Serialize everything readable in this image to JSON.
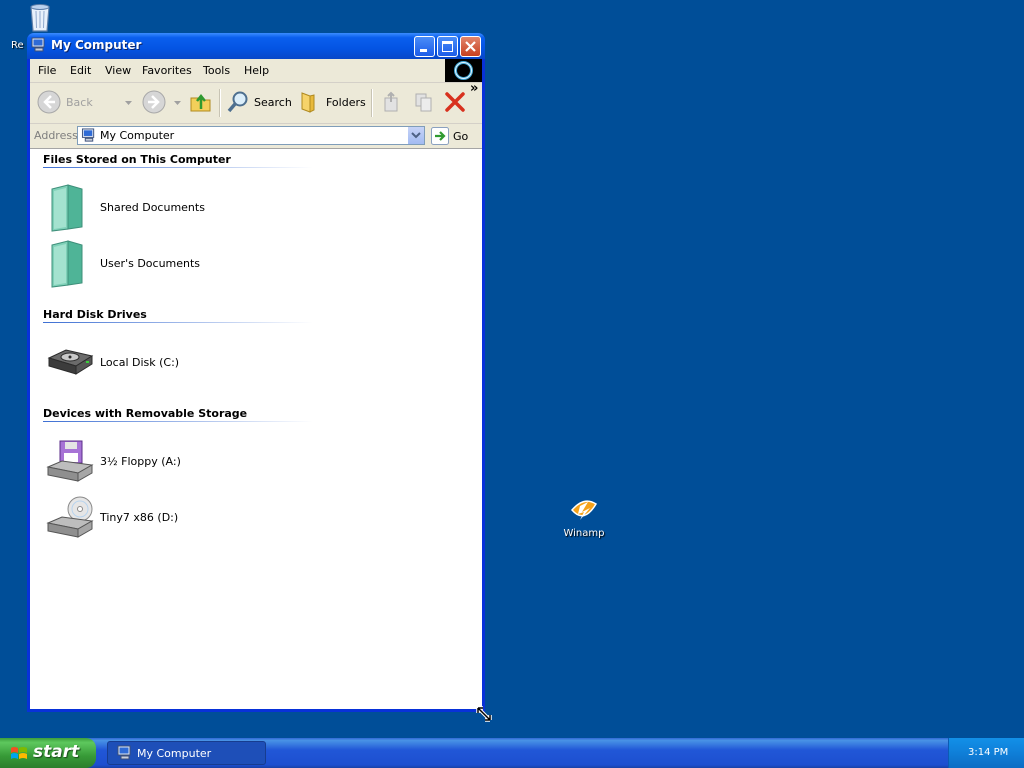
{
  "desktop": {
    "icons": [
      {
        "label": "Re"
      },
      {
        "label": "Winamp"
      }
    ]
  },
  "window": {
    "title": "My Computer",
    "menu": [
      "File",
      "Edit",
      "View",
      "Favorites",
      "Tools",
      "Help"
    ],
    "toolbar": {
      "back": "Back",
      "search": "Search",
      "folders": "Folders",
      "more": "»"
    },
    "address": {
      "label": "Address",
      "value": "My Computer",
      "go": "Go"
    },
    "groups": [
      {
        "title": "Files Stored on This Computer",
        "items": [
          "Shared Documents",
          "User's Documents"
        ]
      },
      {
        "title": "Hard Disk Drives",
        "items": [
          "Local Disk (C:)"
        ]
      },
      {
        "title": "Devices with Removable Storage",
        "items": [
          "3½ Floppy (A:)",
          "Tiny7 x86 (D:)"
        ]
      }
    ]
  },
  "taskbar": {
    "start": "start",
    "items": [
      "My Computer"
    ],
    "clock": "3:14 PM"
  },
  "colors": {
    "desktop": "#004e98",
    "titlebar": "#0454e3",
    "start_green": "#379a37"
  }
}
